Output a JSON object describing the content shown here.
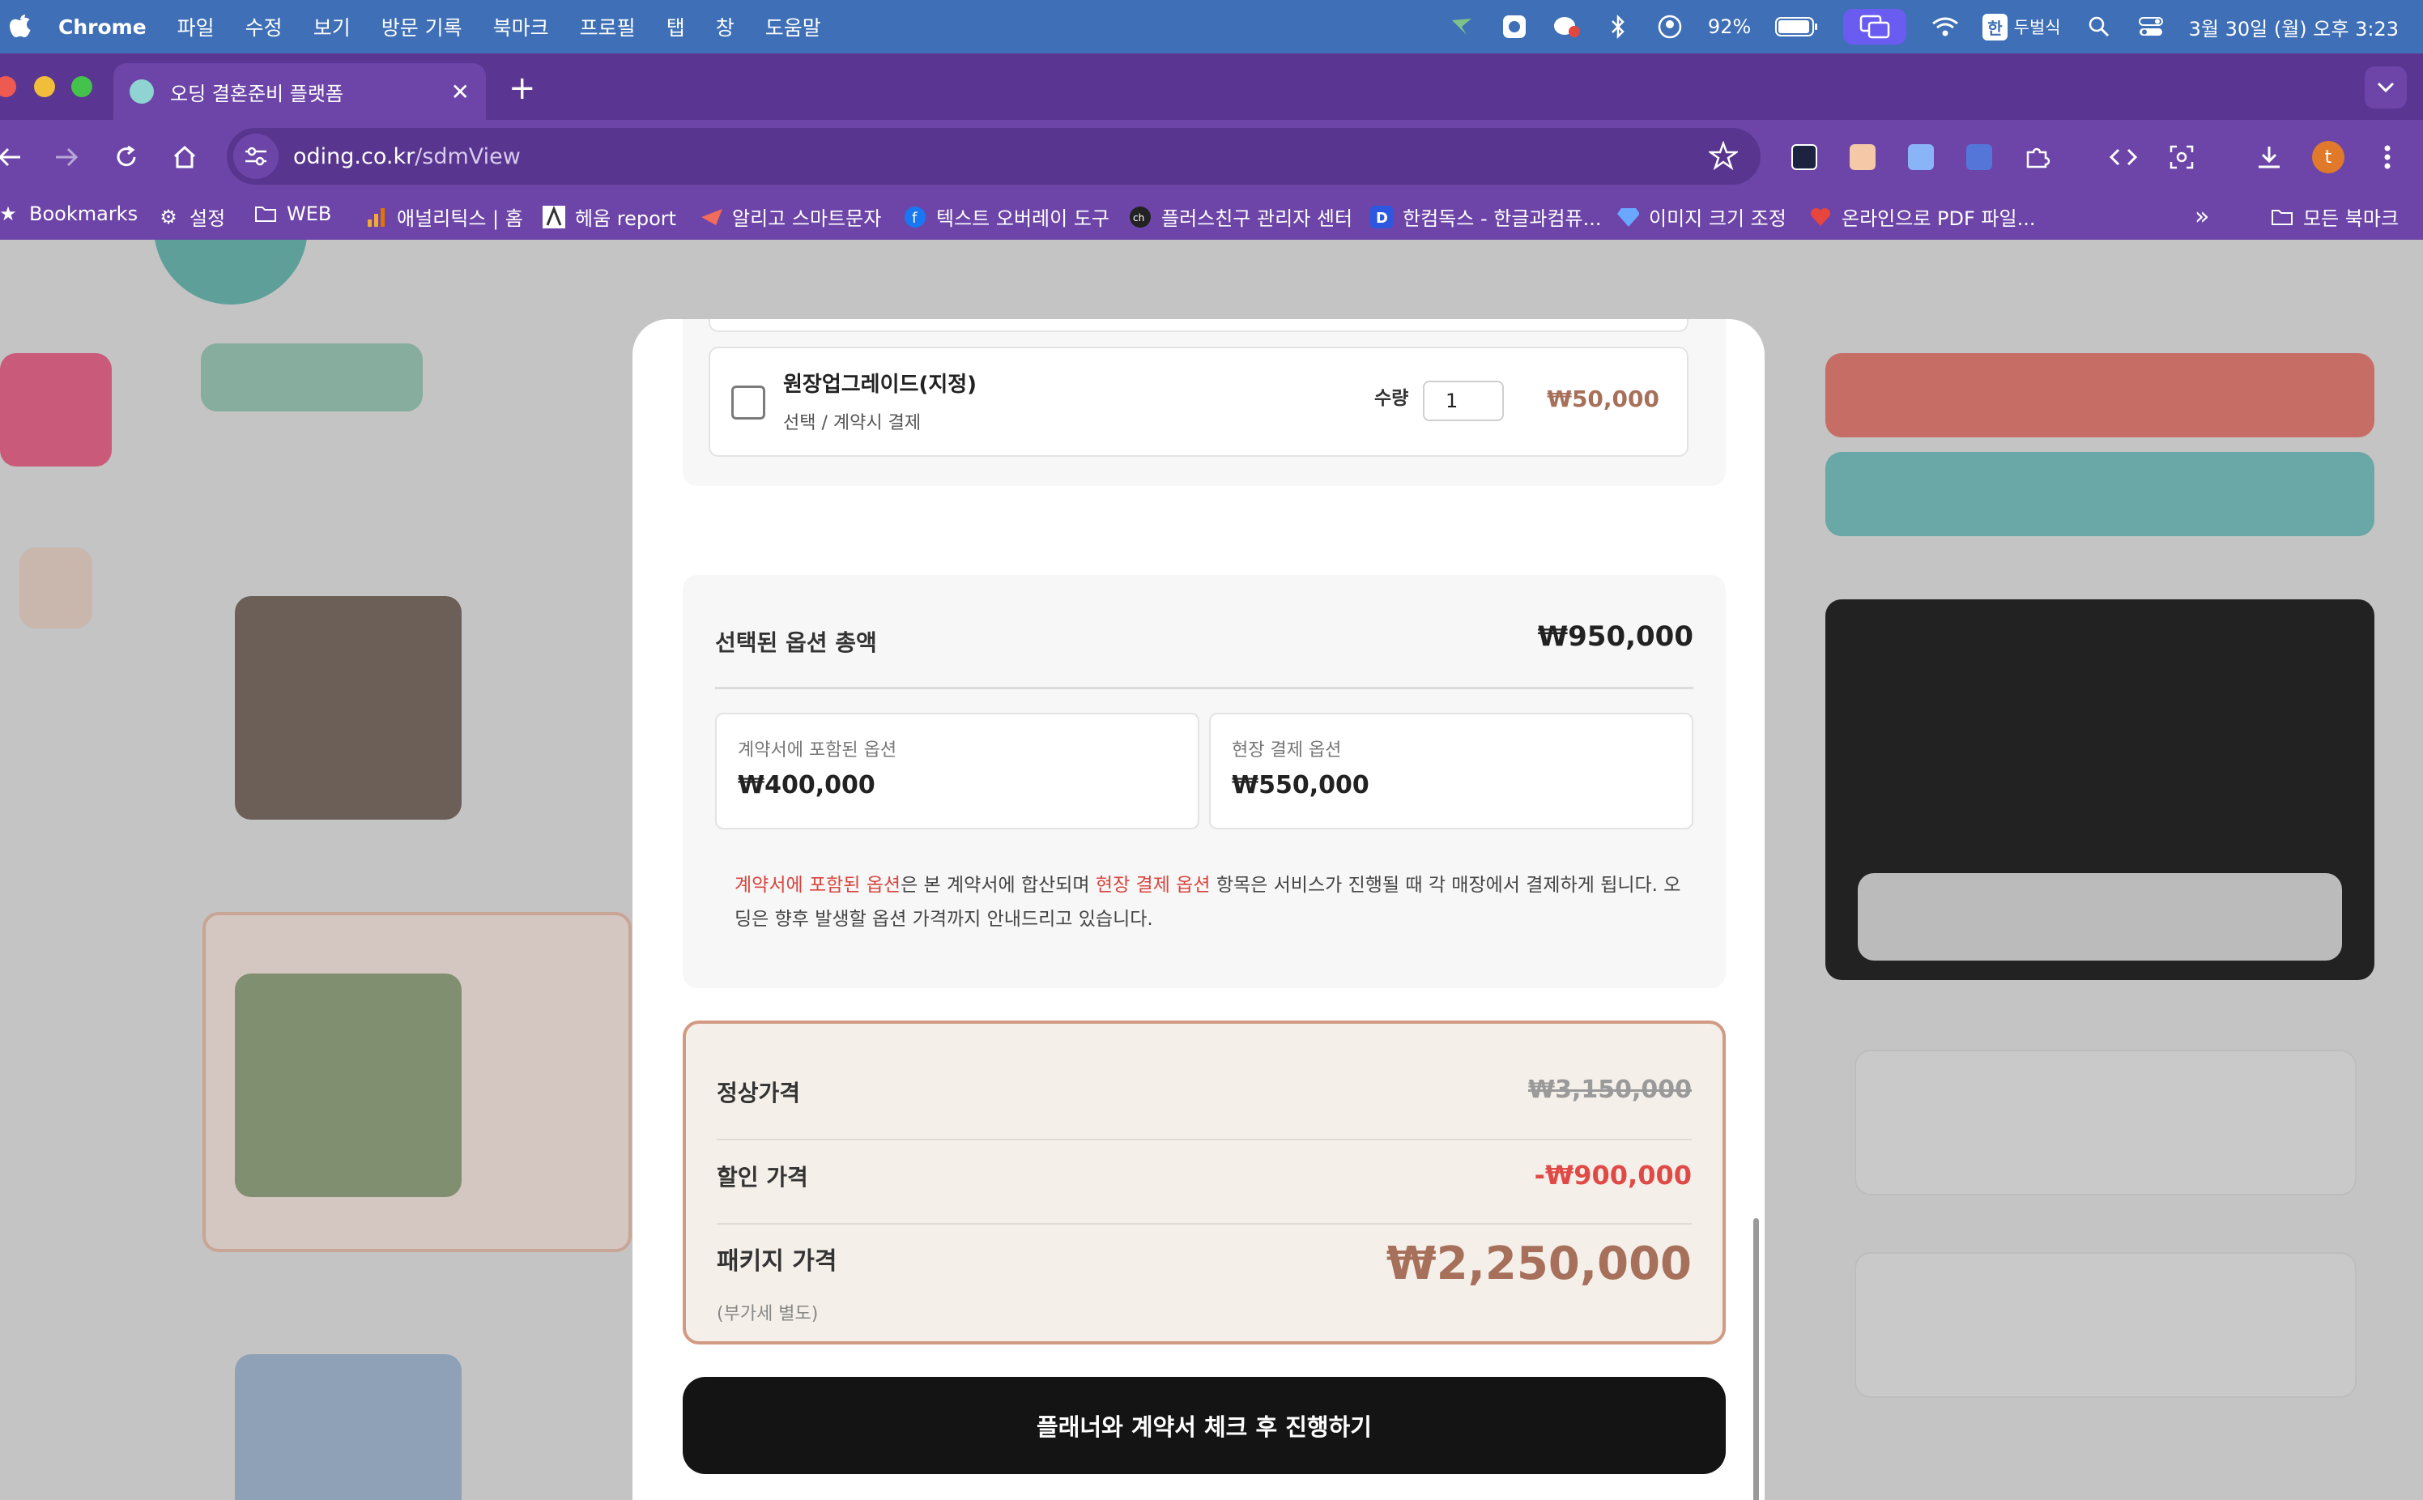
{
  "menubar": {
    "items": [
      "Chrome",
      "파일",
      "수정",
      "보기",
      "방문 기록",
      "북마크",
      "프로필",
      "탭",
      "창",
      "도움말"
    ],
    "battery": "92%",
    "input_method": "한",
    "input_method_name": "두벌식",
    "datetime": "3월 30일 (월) 오후 3:23"
  },
  "tabs": [
    {
      "title": "오딩 결혼준비 플랫폼"
    }
  ],
  "address": {
    "host": "oding.co.kr",
    "path": "/sdmView"
  },
  "profile_initial": "t",
  "bookmarks": [
    "Bookmarks",
    "설정",
    "WEB",
    "애널리틱스 | 홈",
    "헤움 report",
    "알리고 스마트문자",
    "텍스트 오버레이 도구",
    "플러스친구 관리자 센터",
    "한컴독스 - 한글과컴퓨...",
    "이미지 크기 조정",
    "온라인으로 PDF 파일...",
    "모든 북마크"
  ],
  "option": {
    "name": "원장업그레이드(지정)",
    "subtitle": "선택  / 계약시 결제",
    "qty_label": "수량",
    "qty_value": "1",
    "price": "₩50,000"
  },
  "summary": {
    "title": "선택된 옵션 총액",
    "total": "₩950,000",
    "contract_label": "계약서에 포함된 옵션",
    "contract_value": "₩400,000",
    "onsite_label": "현장 결제 옵션",
    "onsite_value": "₩550,000",
    "note_hl1": "계약서에 포함된 옵션",
    "note_part1": "은 본 계약서에 합산되며 ",
    "note_hl2": "현장 결제 옵션",
    "note_part2": " 항목은 서비스가 진행될 때 각 매장에서 결제하게 됩니다. 오딩은 향후 발생할 옵션 가격까지 안내드리고 있습니다."
  },
  "pricing": {
    "regular_label": "정상가격",
    "regular_value": "₩3,150,000",
    "discount_label": "할인 가격",
    "discount_value": "-₩900,000",
    "package_label": "패키지 가격",
    "vat_note": "(부가세 별도)",
    "package_value": "₩2,250,000"
  },
  "cta_label": "플래너와 계약서 체크 후 진행하기",
  "colors": {
    "menubar": "#3f6fb6",
    "chrome_frame": "#6d45a8",
    "accent_brown": "#a7705a",
    "discount_red": "#e04a46",
    "cta_black": "#141414"
  }
}
